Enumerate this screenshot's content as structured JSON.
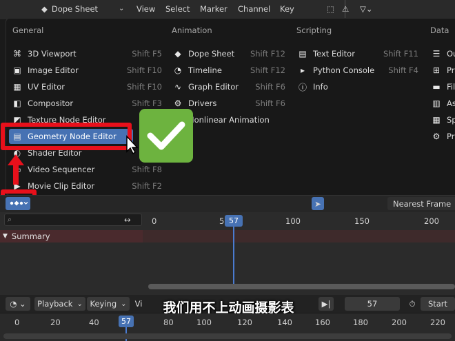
{
  "menu": {
    "general": {
      "header": "General",
      "items": [
        {
          "label": "3D Viewport",
          "shortcut": "Shift F5"
        },
        {
          "label": "Image Editor",
          "shortcut": "Shift F10"
        },
        {
          "label": "UV Editor",
          "shortcut": "Shift F10"
        },
        {
          "label": "Compositor",
          "shortcut": "Shift F3"
        },
        {
          "label": "Texture Node Editor",
          "shortcut": "Sh"
        },
        {
          "label": "Geometry Node Editor",
          "shortcut": ""
        },
        {
          "label": "Shader Editor",
          "shortcut": ""
        },
        {
          "label": "Video Sequencer",
          "shortcut": "Shift F8"
        },
        {
          "label": "Movie Clip Editor",
          "shortcut": "Shift F2"
        }
      ]
    },
    "animation": {
      "header": "Animation",
      "items": [
        {
          "label": "Dope Sheet",
          "shortcut": "Shift F12"
        },
        {
          "label": "Timeline",
          "shortcut": "Shift F12"
        },
        {
          "label": "Graph Editor",
          "shortcut": "Shift F6"
        },
        {
          "label": "Drivers",
          "shortcut": "Shift F6"
        },
        {
          "label": "Nonlinear Animation",
          "shortcut": ""
        }
      ]
    },
    "scripting": {
      "header": "Scripting",
      "items": [
        {
          "label": "Text Editor",
          "shortcut": "Shift F11"
        },
        {
          "label": "Python Console",
          "shortcut": "Shift F4"
        },
        {
          "label": "Info",
          "shortcut": ""
        }
      ]
    },
    "data": {
      "header": "Data",
      "items": [
        {
          "label": "Ou"
        },
        {
          "label": "Pr"
        },
        {
          "label": "Fil"
        },
        {
          "label": "As"
        },
        {
          "label": "Sp"
        },
        {
          "label": "Pr"
        }
      ]
    }
  },
  "toolbar": {
    "editor_type": "Dope Sheet",
    "view": "View",
    "select": "Select",
    "marker": "Marker",
    "channel": "Channel",
    "key": "Key",
    "snap": "Nearest Frame"
  },
  "timeline": {
    "ticks": [
      "0",
      "5",
      "100",
      "150",
      "200"
    ],
    "current_frame": "57",
    "summary": "Summary"
  },
  "transport": {
    "playback": "Playback",
    "keying": "Keying",
    "view_partial": "Vi",
    "frame": "57",
    "start": "Start"
  },
  "subtitle": "我们用不上动画摄影表",
  "ruler": {
    "ticks": [
      "0",
      "20",
      "40",
      "80",
      "100",
      "120",
      "140",
      "160",
      "180",
      "200",
      "220"
    ],
    "current_frame": "57"
  },
  "colors": {
    "selection": "#4772b3",
    "highlight_red": "#e8101b",
    "check_green": "#6db33f"
  }
}
